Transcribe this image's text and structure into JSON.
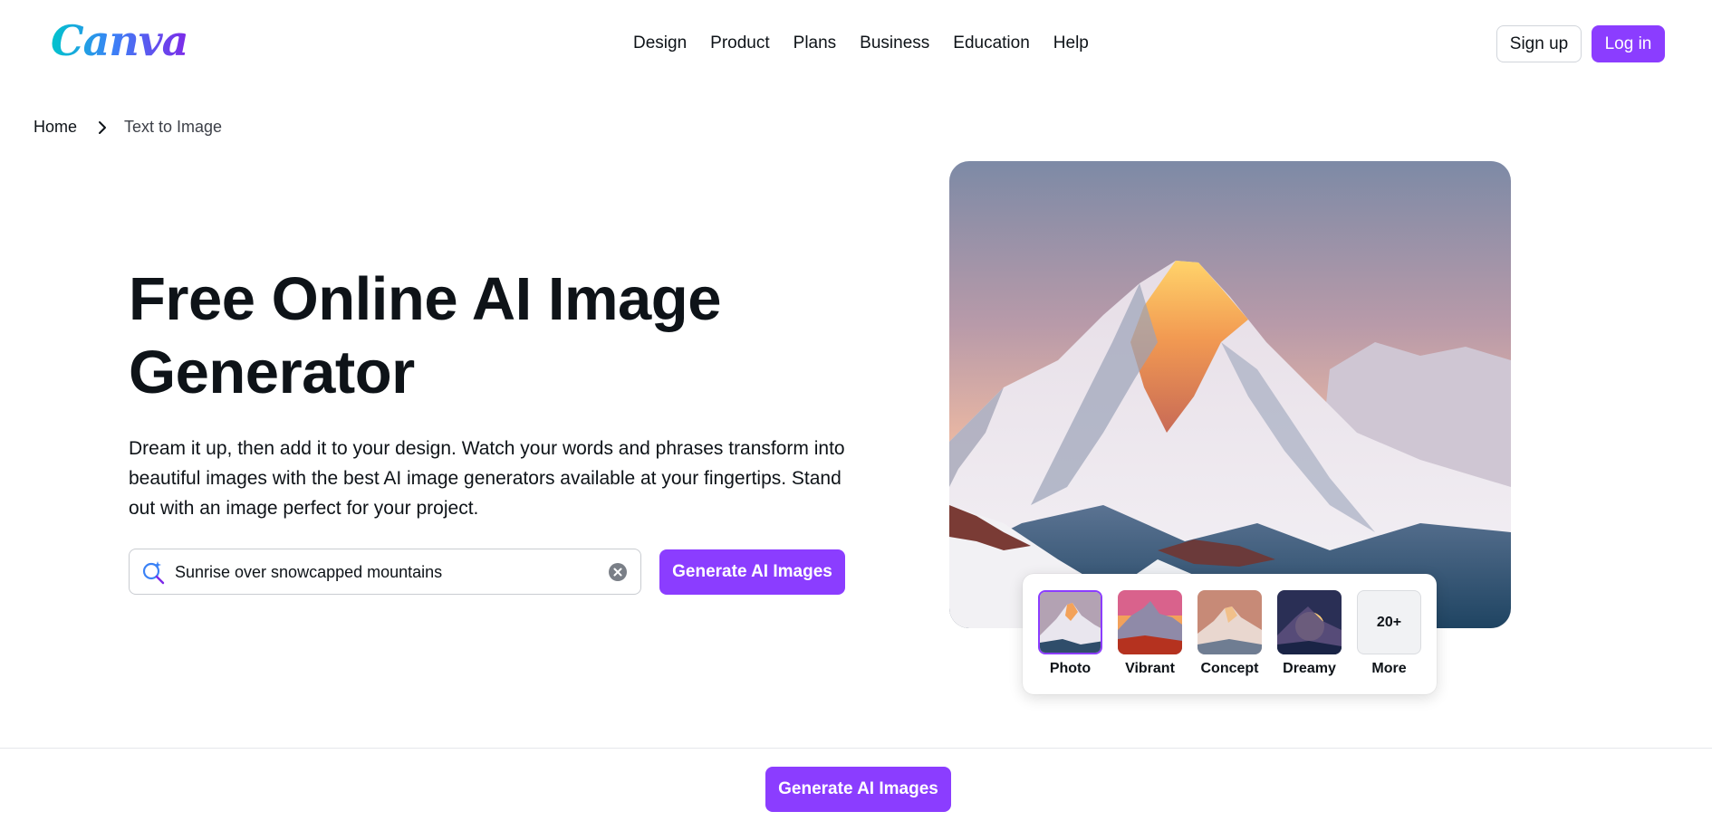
{
  "header": {
    "logo_text": "Canva",
    "nav": [
      {
        "label": "Design"
      },
      {
        "label": "Product"
      },
      {
        "label": "Plans"
      },
      {
        "label": "Business"
      },
      {
        "label": "Education"
      },
      {
        "label": "Help"
      }
    ],
    "signup_label": "Sign up",
    "login_label": "Log in"
  },
  "breadcrumb": {
    "home": "Home",
    "current": "Text to Image",
    "separator_icon": "chevron-right-icon"
  },
  "hero": {
    "title_line1": "Free Online AI Image",
    "title_line2": "Generator",
    "description": "Dream it up, then add it to your design. Watch your words and phrases transform into beautiful images with the best AI image generators available at your fingertips. Stand out with an image perfect for your project.",
    "search": {
      "value": "Sunrise over snowcapped mountains",
      "icon": "ai-search-icon",
      "clear_icon": "clear-icon"
    },
    "generate_label": "Generate AI Images"
  },
  "styles": {
    "selected": "Photo",
    "options": [
      {
        "label": "Photo"
      },
      {
        "label": "Vibrant"
      },
      {
        "label": "Concept"
      },
      {
        "label": "Dreamy"
      },
      {
        "label": "More",
        "badge": "20+"
      }
    ]
  },
  "bottom_bar": {
    "generate_label": "Generate AI Images"
  },
  "colors": {
    "brand_purple": "#8b3dff",
    "text_dark": "#0e1318"
  }
}
